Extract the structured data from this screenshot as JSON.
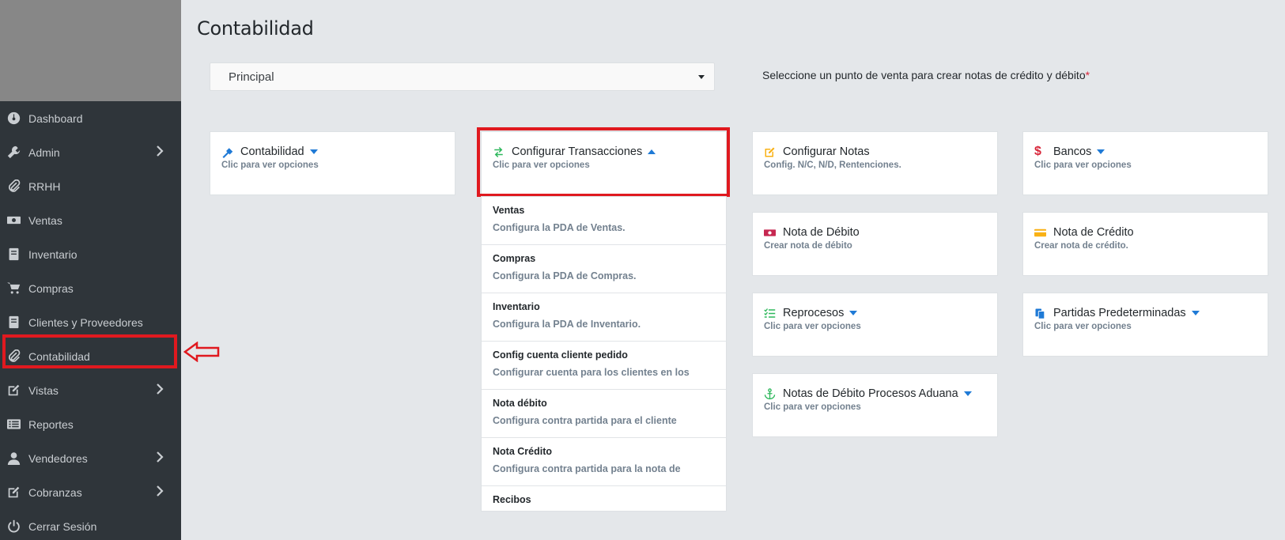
{
  "sidebar": {
    "items": [
      {
        "label": "Dashboard",
        "icon": "dashboard-icon",
        "has_submenu": false
      },
      {
        "label": "Admin",
        "icon": "wrench-icon",
        "has_submenu": true
      },
      {
        "label": "RRHH",
        "icon": "paperclip-icon",
        "has_submenu": false
      },
      {
        "label": "Ventas",
        "icon": "money-icon",
        "has_submenu": false
      },
      {
        "label": "Inventario",
        "icon": "book-icon",
        "has_submenu": false
      },
      {
        "label": "Compras",
        "icon": "cart-icon",
        "has_submenu": false
      },
      {
        "label": "Clientes y Proveedores",
        "icon": "book-icon",
        "has_submenu": false
      },
      {
        "label": "Contabilidad",
        "icon": "paperclip-icon",
        "has_submenu": false,
        "active": true
      },
      {
        "label": "Vistas",
        "icon": "edit-icon",
        "has_submenu": true
      },
      {
        "label": "Reportes",
        "icon": "list-icon",
        "has_submenu": false
      },
      {
        "label": "Vendedores",
        "icon": "user-icon",
        "has_submenu": true
      },
      {
        "label": "Cobranzas",
        "icon": "edit-icon",
        "has_submenu": true
      },
      {
        "label": "Cerrar Sesión",
        "icon": "power-icon",
        "has_submenu": false
      }
    ]
  },
  "header": {
    "title": "Contabilidad"
  },
  "selector": {
    "value": "Principal",
    "hint": "Seleccione un punto de venta para crear notas de crédito y débito",
    "required_mark": "*"
  },
  "cards": {
    "contabilidad": {
      "title": "Contabilidad",
      "subtitle": "Clic para ver opciones",
      "icon": "gavel-icon",
      "icon_color": "#1f7ad6"
    },
    "transacciones": {
      "title": "Configurar Transacciones",
      "subtitle": "Clic para ver opciones",
      "icon": "exchange-icon",
      "icon_color": "#2eb85c"
    },
    "notas": {
      "title": "Configurar Notas",
      "subtitle": "Config. N/C, N/D, Rentenciones.",
      "icon": "edit-icon",
      "icon_color": "#f9b115"
    },
    "bancos": {
      "title": "Bancos",
      "subtitle": "Clic para ver opciones",
      "icon": "dollar-icon",
      "icon_color": "#d8263a"
    },
    "nota_debito": {
      "title": "Nota de Débito",
      "subtitle": "Crear nota de débito",
      "icon": "money-icon",
      "icon_color": "#c62851"
    },
    "nota_credito": {
      "title": "Nota de Crédito",
      "subtitle": "Crear nota de crédito.",
      "icon": "credit-card-icon",
      "icon_color": "#f9b115"
    },
    "reprocesos": {
      "title": "Reprocesos",
      "subtitle": "Clic para ver opciones",
      "icon": "tasks-icon",
      "icon_color": "#2eb85c"
    },
    "partidas": {
      "title": "Partidas Predeterminadas",
      "subtitle": "Clic para ver opciones",
      "icon": "copy-icon",
      "icon_color": "#1f7ad6"
    },
    "aduana": {
      "title": "Notas de Débito Procesos Aduana",
      "subtitle": "Clic para ver opciones",
      "icon": "anchor-icon",
      "icon_color": "#2eb85c"
    }
  },
  "transacciones_menu": [
    {
      "title": "Ventas",
      "subtitle": "Configura la PDA de Ventas."
    },
    {
      "title": "Compras",
      "subtitle": "Configura la PDA de Compras."
    },
    {
      "title": "Inventario",
      "subtitle": "Configura la PDA de Inventario."
    },
    {
      "title": "Config cuenta cliente pedido",
      "subtitle": "Configurar cuenta para los clientes en los"
    },
    {
      "title": "Nota débito",
      "subtitle": "Configura contra partida para el cliente"
    },
    {
      "title": "Nota Crédito",
      "subtitle": "Configura contra partida para la nota de"
    },
    {
      "title": "Recibos",
      "subtitle": ""
    }
  ]
}
